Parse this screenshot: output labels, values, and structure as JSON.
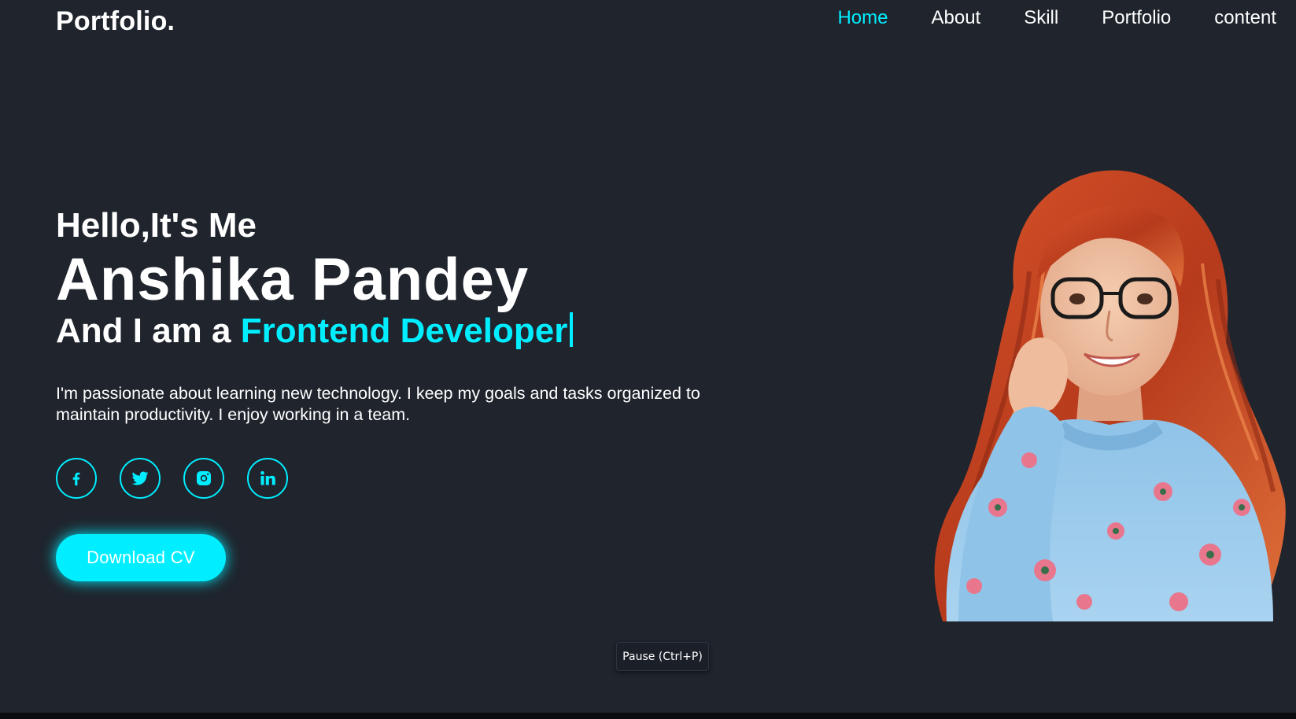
{
  "header": {
    "logo": "Portfolio.",
    "nav": [
      {
        "label": "Home",
        "active": true
      },
      {
        "label": "About",
        "active": false
      },
      {
        "label": "Skill",
        "active": false
      },
      {
        "label": "Portfolio",
        "active": false
      },
      {
        "label": "content",
        "active": false
      }
    ]
  },
  "hero": {
    "greeting": "Hello,It's Me",
    "name": "Anshika Pandey",
    "role_prefix": "And I am a ",
    "role_highlight": "Frontend Developer",
    "description": "I'm passionate about learning new technology. I keep my goals and tasks organized to maintain productivity. I enjoy working in a team.",
    "socials": [
      {
        "icon": "facebook-icon"
      },
      {
        "icon": "twitter-icon"
      },
      {
        "icon": "instagram-icon"
      },
      {
        "icon": "linkedin-icon"
      }
    ],
    "cta_label": "Download CV"
  },
  "tooltip": {
    "text": "Pause (Ctrl+P)"
  },
  "colors": {
    "background": "#1f242d",
    "accent": "#00eeff",
    "text": "#ffffff"
  }
}
